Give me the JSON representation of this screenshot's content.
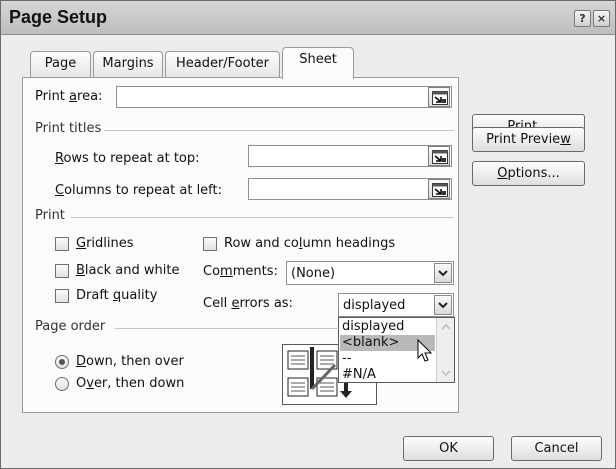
{
  "window": {
    "title": "Page Setup",
    "help_label": "?",
    "close_label": "×"
  },
  "tabs": [
    {
      "label": "Page",
      "active": false
    },
    {
      "label": "Margins",
      "active": false
    },
    {
      "label": "Header/Footer",
      "active": false
    },
    {
      "label": "Sheet",
      "active": true
    }
  ],
  "print_area": {
    "label_pre": "Print ",
    "label_acc": "a",
    "label_post": "rea:",
    "value": ""
  },
  "print_titles": {
    "section_label": "Print titles",
    "rows": {
      "label_pre": "",
      "label_acc": "R",
      "label_post": "ows to repeat at top:",
      "value": ""
    },
    "columns": {
      "label_pre": "",
      "label_acc": "C",
      "label_post": "olumns to repeat at left:",
      "value": ""
    }
  },
  "print": {
    "section_label": "Print",
    "gridlines": {
      "label_pre": "",
      "label_acc": "G",
      "label_post": "ridlines",
      "checked": false
    },
    "black_white": {
      "label_pre": "",
      "label_acc": "B",
      "label_post": "lack and white",
      "checked": false
    },
    "draft_quality": {
      "label_pre": "Draft ",
      "label_acc": "q",
      "label_post": "uality",
      "checked": false
    },
    "row_col_headings": {
      "label_pre": "Row and co",
      "label_acc": "l",
      "label_post": "umn headings",
      "checked": false
    },
    "comments": {
      "label_pre": "Co",
      "label_acc": "m",
      "label_post": "ments:",
      "value": "(None)"
    },
    "cell_errors": {
      "label_pre": "Cell ",
      "label_acc": "e",
      "label_post": "rrors as:",
      "value": "displayed",
      "options": [
        "displayed",
        "<blank>",
        "--",
        "#N/A"
      ],
      "highlighted": "<blank>"
    }
  },
  "page_order": {
    "section_label": "Page order",
    "down_then_over": {
      "label_pre": "",
      "label_acc": "D",
      "label_post": "own, then over",
      "selected": true
    },
    "over_then_down": {
      "label_pre": "O",
      "label_acc": "v",
      "label_post": "er, then down",
      "selected": false
    }
  },
  "side_buttons": {
    "print": {
      "label_pre": "",
      "label_acc": "P",
      "label_post": "rint..."
    },
    "print_preview": {
      "label_pre": "Print Previe",
      "label_acc": "w",
      "label_post": ""
    },
    "options": {
      "label_pre": "",
      "label_acc": "O",
      "label_post": "ptions..."
    }
  },
  "footer": {
    "ok_label": "OK",
    "cancel_label": "Cancel"
  }
}
